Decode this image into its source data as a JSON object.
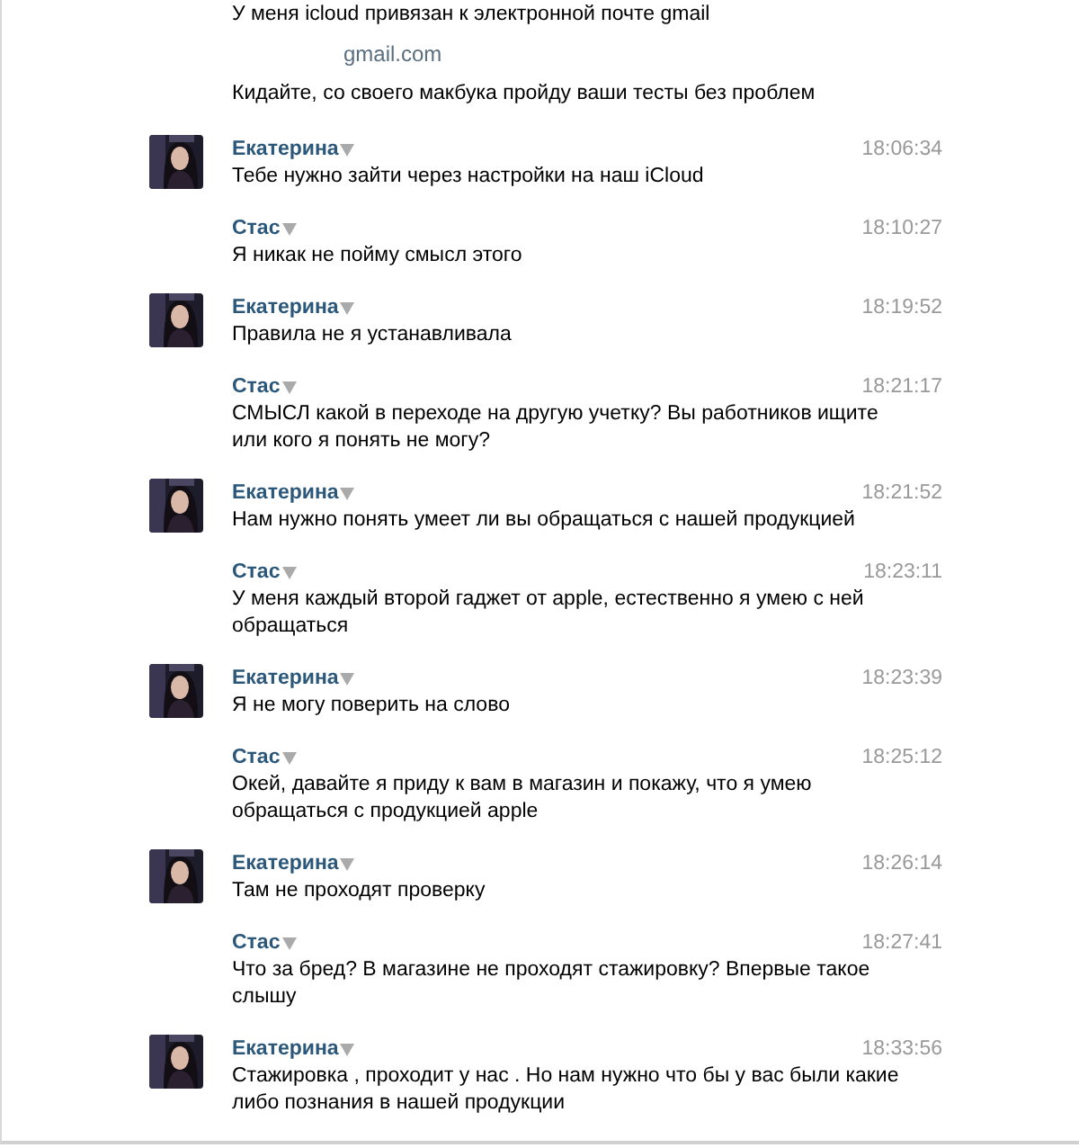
{
  "continued": [
    {
      "kind": "text",
      "text": "У меня icloud привязан к электронной почте gmail"
    },
    {
      "kind": "link",
      "text": "gmail.com"
    },
    {
      "kind": "text",
      "text": "Кидайте, со своего макбука пройду ваши тесты без проблем"
    }
  ],
  "messages": [
    {
      "author": "Екатерина",
      "avatar": true,
      "time": "18:06:34",
      "text": "Тебе нужно зайти через настройки на наш iCloud"
    },
    {
      "author": "Стас",
      "avatar": false,
      "time": "18:10:27",
      "text": "Я никак не пойму смысл этого"
    },
    {
      "author": "Екатерина",
      "avatar": true,
      "time": "18:19:52",
      "text": "Правила не я устанавливала"
    },
    {
      "author": "Стас",
      "avatar": false,
      "time": "18:21:17",
      "text": "СМЫСЛ какой в переходе на другую учетку? Вы работников ищите\nили кого я понять не могу?"
    },
    {
      "author": "Екатерина",
      "avatar": true,
      "time": "18:21:52",
      "text": "Нам нужно понять умеет ли вы обращаться с нашей продукцией"
    },
    {
      "author": "Стас",
      "avatar": false,
      "time": "18:23:11",
      "text": "У меня каждый второй гаджет от apple, естественно я умею с ней\nобращаться"
    },
    {
      "author": "Екатерина",
      "avatar": true,
      "time": "18:23:39",
      "text": "Я не могу поверить на слово"
    },
    {
      "author": "Стас",
      "avatar": false,
      "time": "18:25:12",
      "text": "Окей, давайте я приду к вам в магазин и покажу, что я умею\nобращаться с продукцией apple"
    },
    {
      "author": "Екатерина",
      "avatar": true,
      "time": "18:26:14",
      "text": "Там не проходят проверку"
    },
    {
      "author": "Стас",
      "avatar": false,
      "time": "18:27:41",
      "text": "Что за бред? В магазине не проходят стажировку? Впервые такое\nслышу"
    },
    {
      "author": "Екатерина",
      "avatar": true,
      "time": "18:33:56",
      "text": "Стажировка , проходит у нас . Но нам нужно что бы у вас были какие\nлибо познания в нашей продукции"
    }
  ]
}
